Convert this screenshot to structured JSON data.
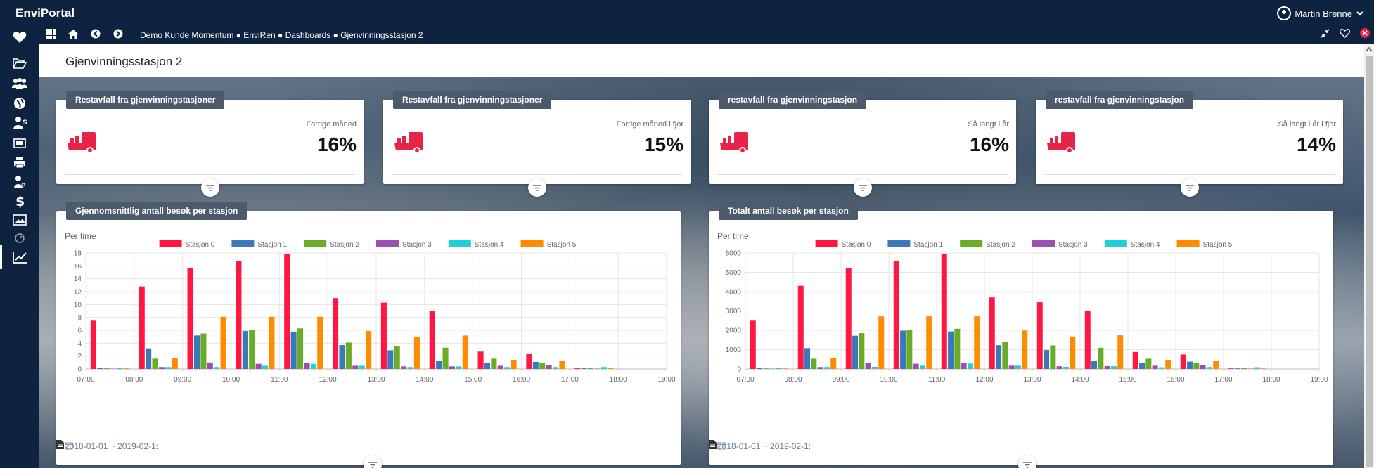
{
  "app": {
    "brand": "EnviPortal",
    "user": "Martin Brenne"
  },
  "nav": {
    "breadcrumb": "Demo Kunde Momentum ● EnviRen ● Dashboards ● Gjenvinningsstasjon 2"
  },
  "sidebar": {
    "items": [
      "favorites",
      "folder",
      "users",
      "globe",
      "person-money",
      "screen",
      "printer",
      "person-key",
      "dollar",
      "image",
      "dashboard",
      "chart"
    ],
    "active": "chart"
  },
  "page": {
    "title": "Gjenvinningsstasjon 2"
  },
  "kpis": [
    {
      "title": "Restavfall fra gjenvinningstasjoner",
      "sub": "Forrige måned",
      "value": "16%"
    },
    {
      "title": "Restavfall fra gjenvinningstasjoner",
      "sub": "Forrige måned i fjor",
      "value": "15%"
    },
    {
      "title": "restavfall fra gjenvinningstasjon",
      "sub": "Så langt i år",
      "value": "16%"
    },
    {
      "title": "restavfall fra gjenvinningstasjon",
      "sub": "Så langt i år i fjor",
      "value": "14%"
    }
  ],
  "colors": {
    "kpi_icon": "#e8234a",
    "header": "#0d2340",
    "label_bg": "#4d5a6b"
  },
  "charts": [
    {
      "title": "Gjennomsnittlig antall besøk per stasjon",
      "subtitle": "Per time",
      "footer": "2018-01-01 ~ 2019-02-1:"
    },
    {
      "title": "Totalt antall besøk per stasjon",
      "subtitle": "Per time",
      "footer": "2018-01-01 ~ 2019-02-1:"
    }
  ],
  "chart_data": [
    {
      "type": "bar",
      "categories": [
        "07:00",
        "08:00",
        "09:00",
        "10:00",
        "11:00",
        "12:00",
        "13:00",
        "14:00",
        "15:00",
        "16:00",
        "17:00",
        "18:00",
        "19:00"
      ],
      "ylim": [
        0,
        18
      ],
      "yticks": [
        0,
        2,
        4,
        6,
        8,
        10,
        12,
        14,
        16,
        18
      ],
      "series": [
        {
          "name": "Stasjon 0",
          "color": "#ff1744",
          "values": [
            7.5,
            12.8,
            15.6,
            16.8,
            17.8,
            11.0,
            10.3,
            9.0,
            2.7,
            2.3,
            0.1
          ]
        },
        {
          "name": "Stasjon 1",
          "color": "#3a7ab8",
          "values": [
            0.2,
            3.2,
            5.2,
            5.9,
            5.8,
            3.7,
            2.9,
            1.2,
            0.9,
            1.1,
            0.1
          ]
        },
        {
          "name": "Stasjon 2",
          "color": "#6aab27",
          "values": [
            0.1,
            1.6,
            5.5,
            6.0,
            6.3,
            4.1,
            3.6,
            3.3,
            1.6,
            0.9,
            0.2
          ]
        },
        {
          "name": "Stasjon 3",
          "color": "#9b4fae",
          "values": [
            0.05,
            0.3,
            1.0,
            0.8,
            0.9,
            0.5,
            0.4,
            0.4,
            0.5,
            0.6,
            0.05
          ]
        },
        {
          "name": "Stasjon 4",
          "color": "#22cfd6",
          "values": [
            0.2,
            0.3,
            0.3,
            0.5,
            0.8,
            0.5,
            0.3,
            0.4,
            0.3,
            0.3,
            0.3
          ]
        },
        {
          "name": "Stasjon 5",
          "color": "#ff8c00",
          "values": [
            0.1,
            1.7,
            8.1,
            8.1,
            8.1,
            5.9,
            5.0,
            5.2,
            1.4,
            1.2,
            0.1
          ]
        }
      ]
    },
    {
      "type": "bar",
      "categories": [
        "07:00",
        "08:00",
        "09:00",
        "10:00",
        "11:00",
        "12:00",
        "13:00",
        "14:00",
        "15:00",
        "16:00",
        "17:00",
        "18:00",
        "19:00"
      ],
      "ylim": [
        0,
        6000
      ],
      "yticks": [
        0,
        1000,
        2000,
        3000,
        4000,
        5000,
        6000
      ],
      "series": [
        {
          "name": "Stasjon 0",
          "color": "#ff1744",
          "values": [
            2500,
            4300,
            5200,
            5600,
            5950,
            3700,
            3450,
            3000,
            880,
            750,
            30
          ]
        },
        {
          "name": "Stasjon 1",
          "color": "#3a7ab8",
          "values": [
            60,
            1080,
            1720,
            1980,
            1940,
            1230,
            980,
            400,
            300,
            380,
            30
          ]
        },
        {
          "name": "Stasjon 2",
          "color": "#6aab27",
          "values": [
            30,
            530,
            1850,
            2020,
            2080,
            1390,
            1220,
            1100,
            530,
            300,
            70
          ]
        },
        {
          "name": "Stasjon 3",
          "color": "#9b4fae",
          "values": [
            15,
            100,
            320,
            270,
            300,
            170,
            140,
            150,
            170,
            200,
            15
          ]
        },
        {
          "name": "Stasjon 4",
          "color": "#22cfd6",
          "values": [
            60,
            100,
            110,
            170,
            280,
            170,
            110,
            140,
            90,
            100,
            90
          ]
        },
        {
          "name": "Stasjon 5",
          "color": "#ff8c00",
          "values": [
            30,
            560,
            2720,
            2720,
            2720,
            1990,
            1680,
            1740,
            460,
            400,
            30
          ]
        }
      ]
    }
  ]
}
